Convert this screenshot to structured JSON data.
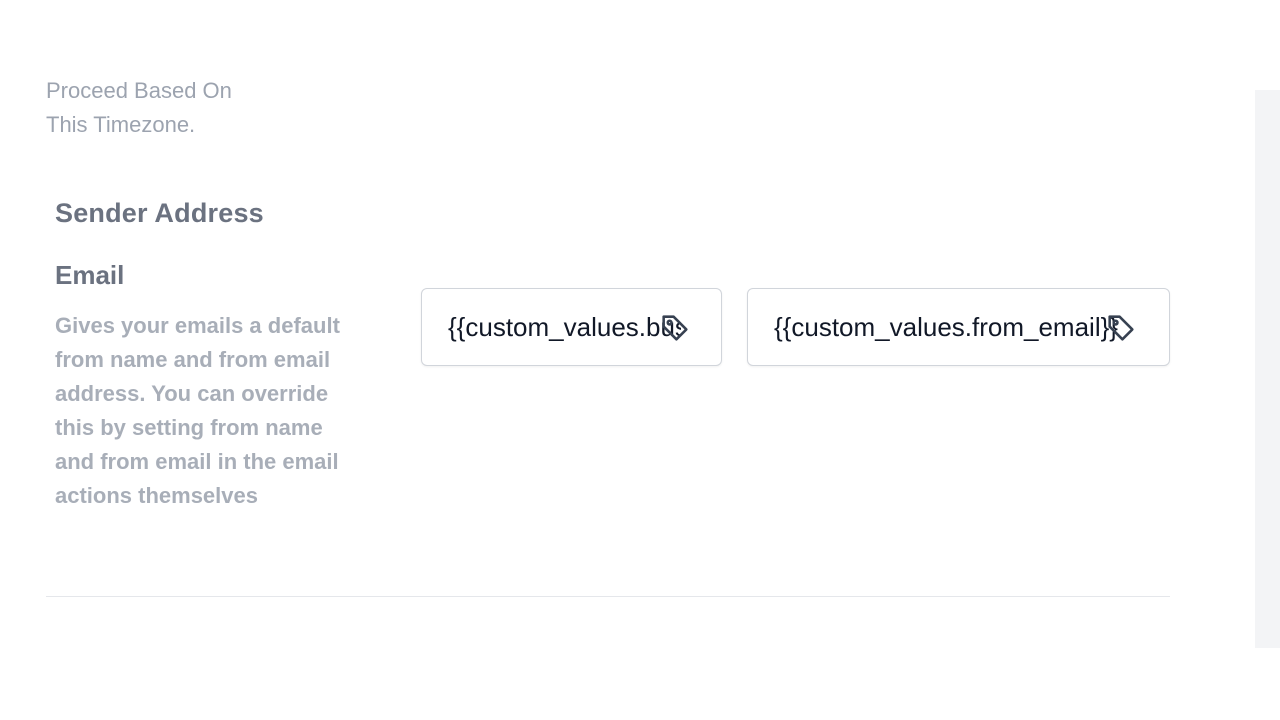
{
  "timezone_note": "Proceed Based On\nThis Timezone.",
  "sender_address": {
    "heading": "Sender Address",
    "email": {
      "title": "Email",
      "description": "Gives your emails a default from name and from email address. You can override this by setting from name and from email in the email actions themselves",
      "from_name_value": "{{custom_values.business_name}}",
      "from_email_value": "{{custom_values.from_email}}"
    }
  },
  "icons": {
    "from_name_picker": "tag-icon",
    "from_email_picker": "tag-icon"
  },
  "colors": {
    "heading": "#6b7280",
    "muted_text": "#9ca3af",
    "input_border": "#d1d5db",
    "input_text": "#111827",
    "right_panel": "#f3f4f6"
  }
}
